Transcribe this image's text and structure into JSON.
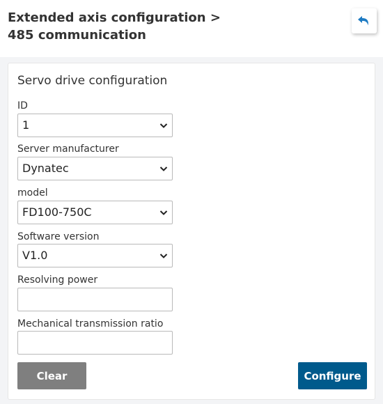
{
  "header": {
    "title_line1": "Extended axis configuration >",
    "title_line2": "485 communication",
    "back_icon": "back-arrow-icon"
  },
  "card": {
    "title": "Servo drive configuration",
    "fields": [
      {
        "label": "ID",
        "type": "select",
        "value": "1"
      },
      {
        "label": "Server manufacturer",
        "type": "select",
        "value": "Dynatec"
      },
      {
        "label": "model",
        "type": "select",
        "value": "FD100-750C"
      },
      {
        "label": "Software version",
        "type": "select",
        "value": "V1.0"
      },
      {
        "label": "Resolving power",
        "type": "text",
        "value": ""
      },
      {
        "label": "Mechanical transmission ratio",
        "type": "text",
        "value": ""
      }
    ]
  },
  "buttons": {
    "clear": "Clear",
    "configure": "Configure"
  },
  "colors": {
    "accent": "#005a8c",
    "clear_button": "#7f7f7f",
    "back_icon": "#1e7bc3"
  }
}
